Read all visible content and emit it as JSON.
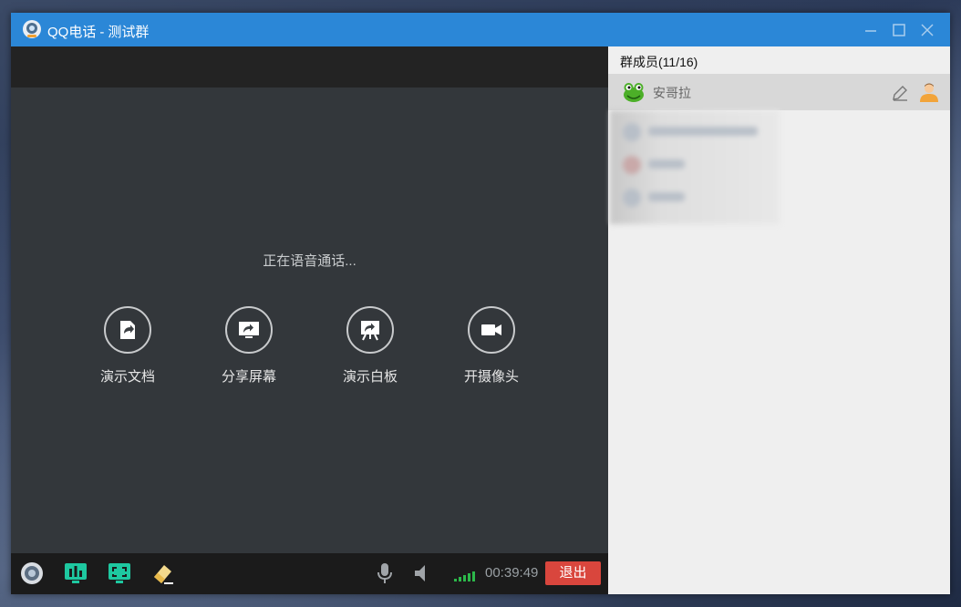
{
  "window": {
    "app_name": "QQ电话",
    "separator": "-",
    "group_name": "测试群"
  },
  "call": {
    "status": "正在语音通话...",
    "actions": [
      {
        "label": "演示文档",
        "icon": "share-document-icon"
      },
      {
        "label": "分享屏幕",
        "icon": "share-screen-icon"
      },
      {
        "label": "演示白板",
        "icon": "whiteboard-icon"
      },
      {
        "label": "开摄像头",
        "icon": "camera-icon"
      }
    ],
    "toolbar": {
      "timer": "00:39:49",
      "exit_label": "退出",
      "signal_bars": 5
    }
  },
  "members": {
    "header": "群成员(11/16)",
    "list": [
      {
        "name": "安哥拉",
        "avatar": "frog-avatar-icon"
      }
    ]
  },
  "colors": {
    "titlebar": "#2b87d7",
    "call_bg": "#33373b",
    "exit": "#d9463d",
    "accent_green": "#1ec8a0"
  }
}
